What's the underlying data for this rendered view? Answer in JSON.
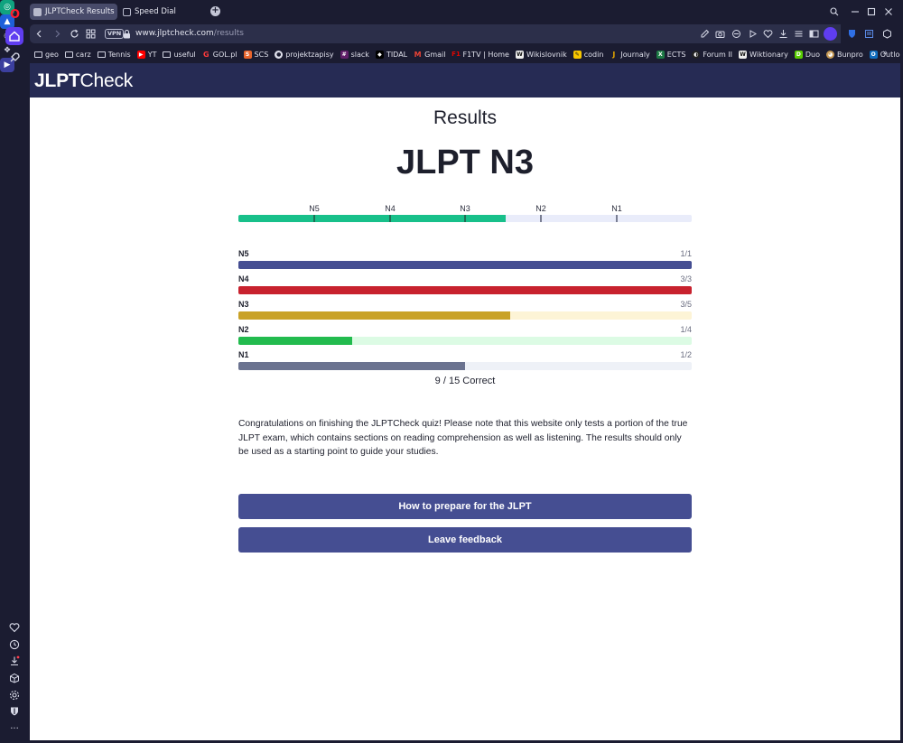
{
  "browser": {
    "tabs": [
      {
        "title": "JLPTCheck Results",
        "active": true
      },
      {
        "title": "Speed Dial",
        "active": false
      }
    ],
    "url": {
      "host": "www.jlptcheck.com",
      "path": "/results"
    },
    "vpn_label": "VPN",
    "bookmarks": [
      "geo",
      "carz",
      "Tennis",
      "YT",
      "useful",
      "GOL.pl",
      "SCS",
      "projektzapisy",
      "slack",
      "TIDAL",
      "Gmail",
      "F1TV | Home",
      "Wikislovnik",
      "codin",
      "Journaly",
      "ECTS",
      "Forum II",
      "Wiktionary",
      "Duo",
      "Bunpro",
      "Outlook"
    ],
    "colors": {
      "chrome_bg": "#1b1c31",
      "accent": "#5f3df0"
    }
  },
  "site": {
    "brand_bold": "JLPT",
    "brand_light": "Check",
    "header_color": "#262b54"
  },
  "results": {
    "heading": "Results",
    "level": "JLPT N3",
    "overall": {
      "labels": [
        "N5",
        "N4",
        "N3",
        "N2",
        "N1"
      ],
      "progress_fraction": 0.59,
      "fill_color": "#18c08a"
    },
    "levels": [
      {
        "name": "N5",
        "score": "1/1",
        "correct": 1,
        "total": 1,
        "color": "#454e92",
        "track": "#e3e6f6"
      },
      {
        "name": "N4",
        "score": "3/3",
        "correct": 3,
        "total": 3,
        "color": "#c8222e",
        "track": "#fbe3e4"
      },
      {
        "name": "N3",
        "score": "3/5",
        "correct": 3,
        "total": 5,
        "color": "#c9a227",
        "track": "#fdf4d6"
      },
      {
        "name": "N2",
        "score": "1/4",
        "correct": 1,
        "total": 4,
        "color": "#22bb4e",
        "track": "#dcfbe4"
      },
      {
        "name": "N1",
        "score": "1/2",
        "correct": 1,
        "total": 2,
        "color": "#6b7390",
        "track": "#eef1f7"
      }
    ],
    "correct_text": "9 / 15 Correct",
    "note": "Congratulations on finishing the JLPTCheck quiz! Please note that this website only tests a portion of the true JLPT exam, which contains sections on reading comprehension as well as listening. The results should only be used as a starting point to guide your studies.",
    "buttons": {
      "prepare": "How to prepare for the JLPT",
      "feedback": "Leave feedback"
    }
  }
}
